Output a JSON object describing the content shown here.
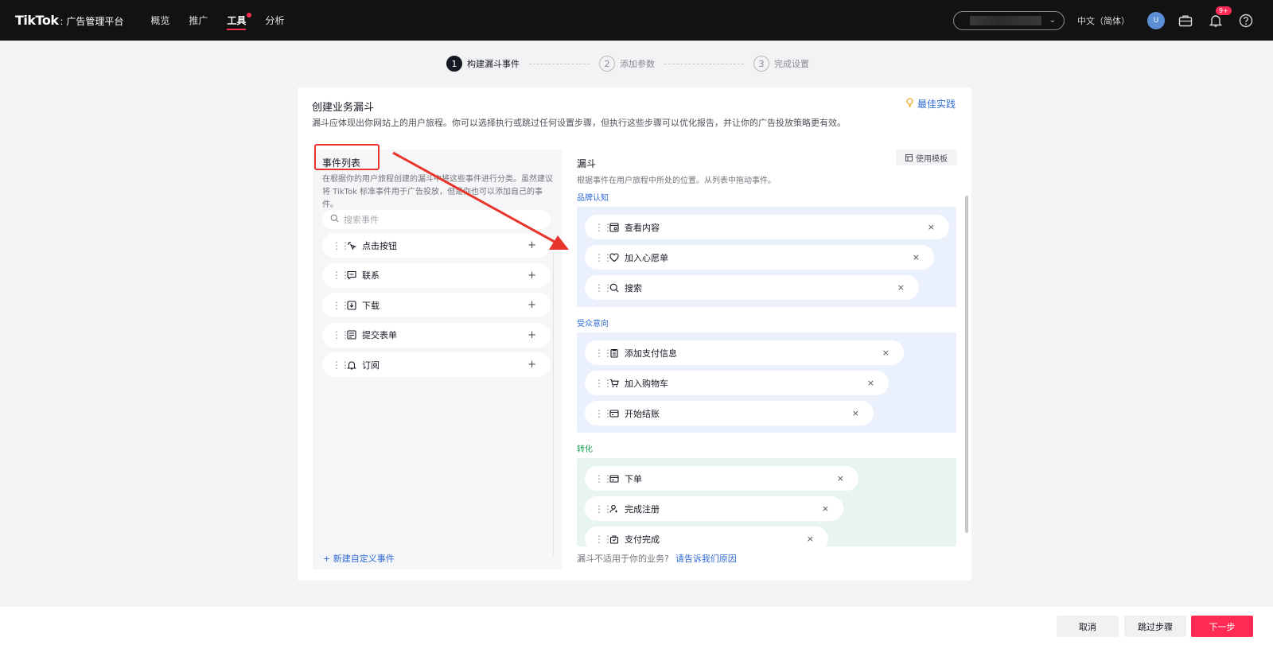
{
  "topbar": {
    "logo_main": "TikTok",
    "logo_sub": ": 广告管理平台",
    "nav": [
      {
        "label": "概览"
      },
      {
        "label": "推广"
      },
      {
        "label": "工具"
      },
      {
        "label": "分析"
      }
    ],
    "language": "中文（简体）",
    "avatar_letter": "U",
    "notification_badge": "9+"
  },
  "steps": [
    {
      "num": "1",
      "label": "构建漏斗事件"
    },
    {
      "num": "2",
      "label": "添加参数"
    },
    {
      "num": "3",
      "label": "完成设置"
    }
  ],
  "card": {
    "title": "创建业务漏斗",
    "description": "漏斗应体现出你网站上的用户旅程。你可以选择执行或跳过任何设置步骤，但执行这些步骤可以优化报告，并让你的广告投放策略更有效。",
    "best_practice": "最佳实践"
  },
  "event_list": {
    "title": "事件列表",
    "description": "在根据你的用户旅程创建的漏斗中将这些事件进行分类。虽然建议将 TikTok 标准事件用于广告投放，但是你也可以添加自己的事件。",
    "search_placeholder": "搜索事件",
    "events": [
      {
        "label": "点击按钮",
        "icon": "click-icon"
      },
      {
        "label": "联系",
        "icon": "chat-icon"
      },
      {
        "label": "下载",
        "icon": "download-icon"
      },
      {
        "label": "提交表单",
        "icon": "form-icon"
      },
      {
        "label": "订阅",
        "icon": "bell-icon"
      }
    ],
    "add_custom": "+ 新建自定义事件"
  },
  "funnel": {
    "title": "漏斗",
    "description": "根据事件在用户旅程中所处的位置。从列表中拖动事件。",
    "use_template": "使用模板",
    "sections": [
      {
        "label": "品牌认知",
        "color": "#2f6bd6",
        "bg": "#ebf0fd",
        "events": [
          {
            "label": "查看内容",
            "icon": "view-content-icon"
          },
          {
            "label": "加入心愿单",
            "icon": "heart-icon"
          },
          {
            "label": "搜索",
            "icon": "search-icon"
          }
        ]
      },
      {
        "label": "受众意向",
        "color": "#2f6bd6",
        "bg": "#ebf0fd",
        "events": [
          {
            "label": "添加支付信息",
            "icon": "clipboard-icon"
          },
          {
            "label": "加入购物车",
            "icon": "cart-icon"
          },
          {
            "label": "开始结账",
            "icon": "checkout-icon"
          }
        ]
      },
      {
        "label": "转化",
        "color": "#1a9e55",
        "bg": "#e8f5ee",
        "events": [
          {
            "label": "下单",
            "icon": "order-icon"
          },
          {
            "label": "完成注册",
            "icon": "user-add-icon"
          },
          {
            "label": "支付完成",
            "icon": "bag-icon"
          }
        ]
      }
    ],
    "footnote": "漏斗不适用于你的业务?",
    "footnote_link": "请告诉我们原因"
  },
  "actions": {
    "cancel": "取消",
    "skip": "跳过步骤",
    "next": "下一步"
  },
  "colors": {
    "accent": "#fe2c55",
    "link": "#2f6bd6",
    "annotation": "#e8352c"
  }
}
